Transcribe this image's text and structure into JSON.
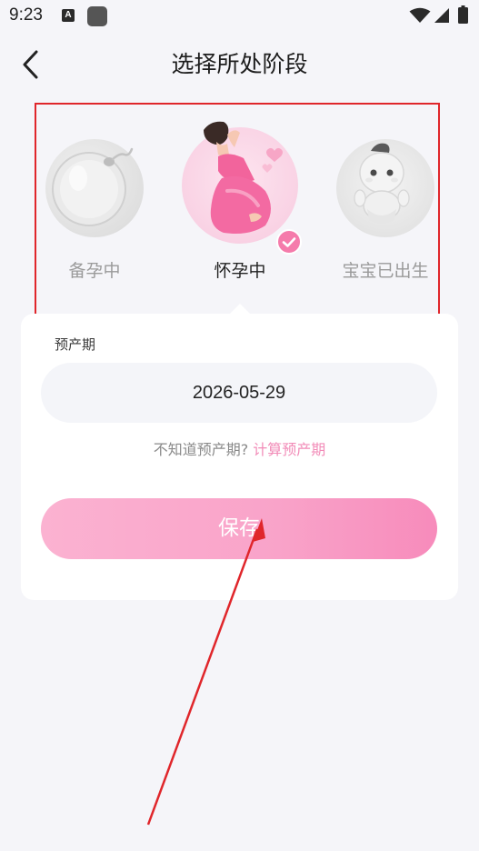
{
  "status_bar": {
    "time": "9:23",
    "notification_icon_letter": "A",
    "icons": [
      "a-notification-icon",
      "app-square-icon",
      "wifi-icon",
      "cell-signal-icon",
      "battery-icon"
    ]
  },
  "header": {
    "title": "选择所处阶段",
    "back_icon": "chevron-left-icon"
  },
  "stages": [
    {
      "label": "备孕中",
      "icon": "egg-sperm-icon",
      "selected": false
    },
    {
      "label": "怀孕中",
      "icon": "pregnant-woman-icon",
      "selected": true
    },
    {
      "label": "宝宝已出生",
      "icon": "baby-icon",
      "selected": false
    }
  ],
  "form": {
    "due_date_label": "预产期",
    "due_date_value": "2026-05-29",
    "hint_text": "不知道预产期?",
    "hint_link": "计算预产期",
    "save_label": "保存"
  },
  "colors": {
    "accent_pink": "#f57bab",
    "save_gradient_start": "#fbb2d1",
    "save_gradient_end": "#f78bbb",
    "annotation_red": "#e0262b",
    "background": "#f5f5f9"
  }
}
